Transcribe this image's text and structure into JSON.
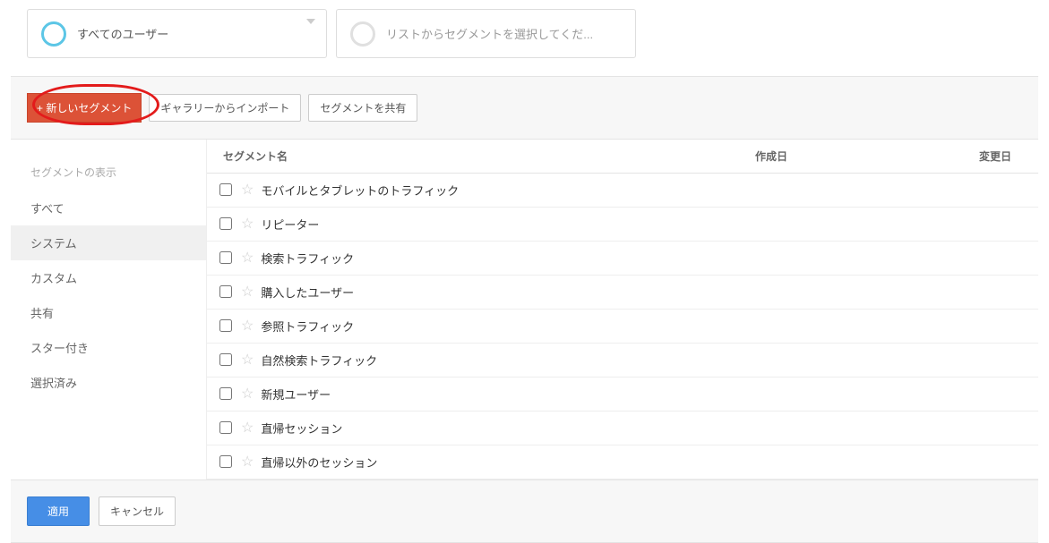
{
  "topSegments": {
    "active": "すべてのユーザー",
    "placeholder": "リストからセグメントを選択してくだ..."
  },
  "toolbar": {
    "newSegment": "+ 新しいセグメント",
    "importGallery": "ギャラリーからインポート",
    "shareSegment": "セグメントを共有"
  },
  "sidebar": {
    "title": "セグメントの表示",
    "items": [
      "すべて",
      "システム",
      "カスタム",
      "共有",
      "スター付き",
      "選択済み"
    ]
  },
  "table": {
    "headers": {
      "name": "セグメント名",
      "created": "作成日",
      "modified": "変更日"
    },
    "rows": [
      {
        "name": "モバイルとタブレットのトラフィック"
      },
      {
        "name": "リピーター"
      },
      {
        "name": "検索トラフィック"
      },
      {
        "name": "購入したユーザー"
      },
      {
        "name": "参照トラフィック"
      },
      {
        "name": "自然検索トラフィック"
      },
      {
        "name": "新規ユーザー"
      },
      {
        "name": "直帰セッション"
      },
      {
        "name": "直帰以外のセッション"
      }
    ]
  },
  "footer": {
    "apply": "適用",
    "cancel": "キャンセル"
  }
}
